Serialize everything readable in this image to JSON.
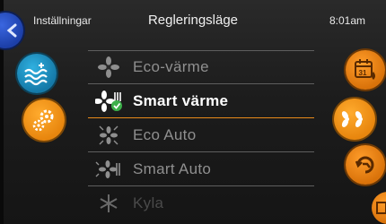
{
  "header": {
    "left_label": "Inställningar",
    "title": "Regleringsläge",
    "time": "8:01am"
  },
  "modes": [
    {
      "label": "Eco-värme",
      "icon": "fan-icon",
      "selected": false
    },
    {
      "label": "Smart värme",
      "icon": "fan-heat-check-icon",
      "selected": true
    },
    {
      "label": "Eco Auto",
      "icon": "fan-auto-icon",
      "selected": false
    },
    {
      "label": "Smart Auto",
      "icon": "fan-heat-auto-icon",
      "selected": false
    },
    {
      "label": "Kyla",
      "icon": "snowflake-icon",
      "selected": false
    }
  ],
  "side_buttons": {
    "left": [
      "back-icon",
      "water-heat-icon",
      "settings-icon"
    ],
    "right": [
      "calendar-icon",
      "regulation-mode-icon",
      "cycle-icon",
      "filter-icon"
    ]
  },
  "colors": {
    "accent": "#e8860e",
    "water": "#1579a8",
    "back": "#1c3fa8",
    "check": "#3cb04a"
  }
}
